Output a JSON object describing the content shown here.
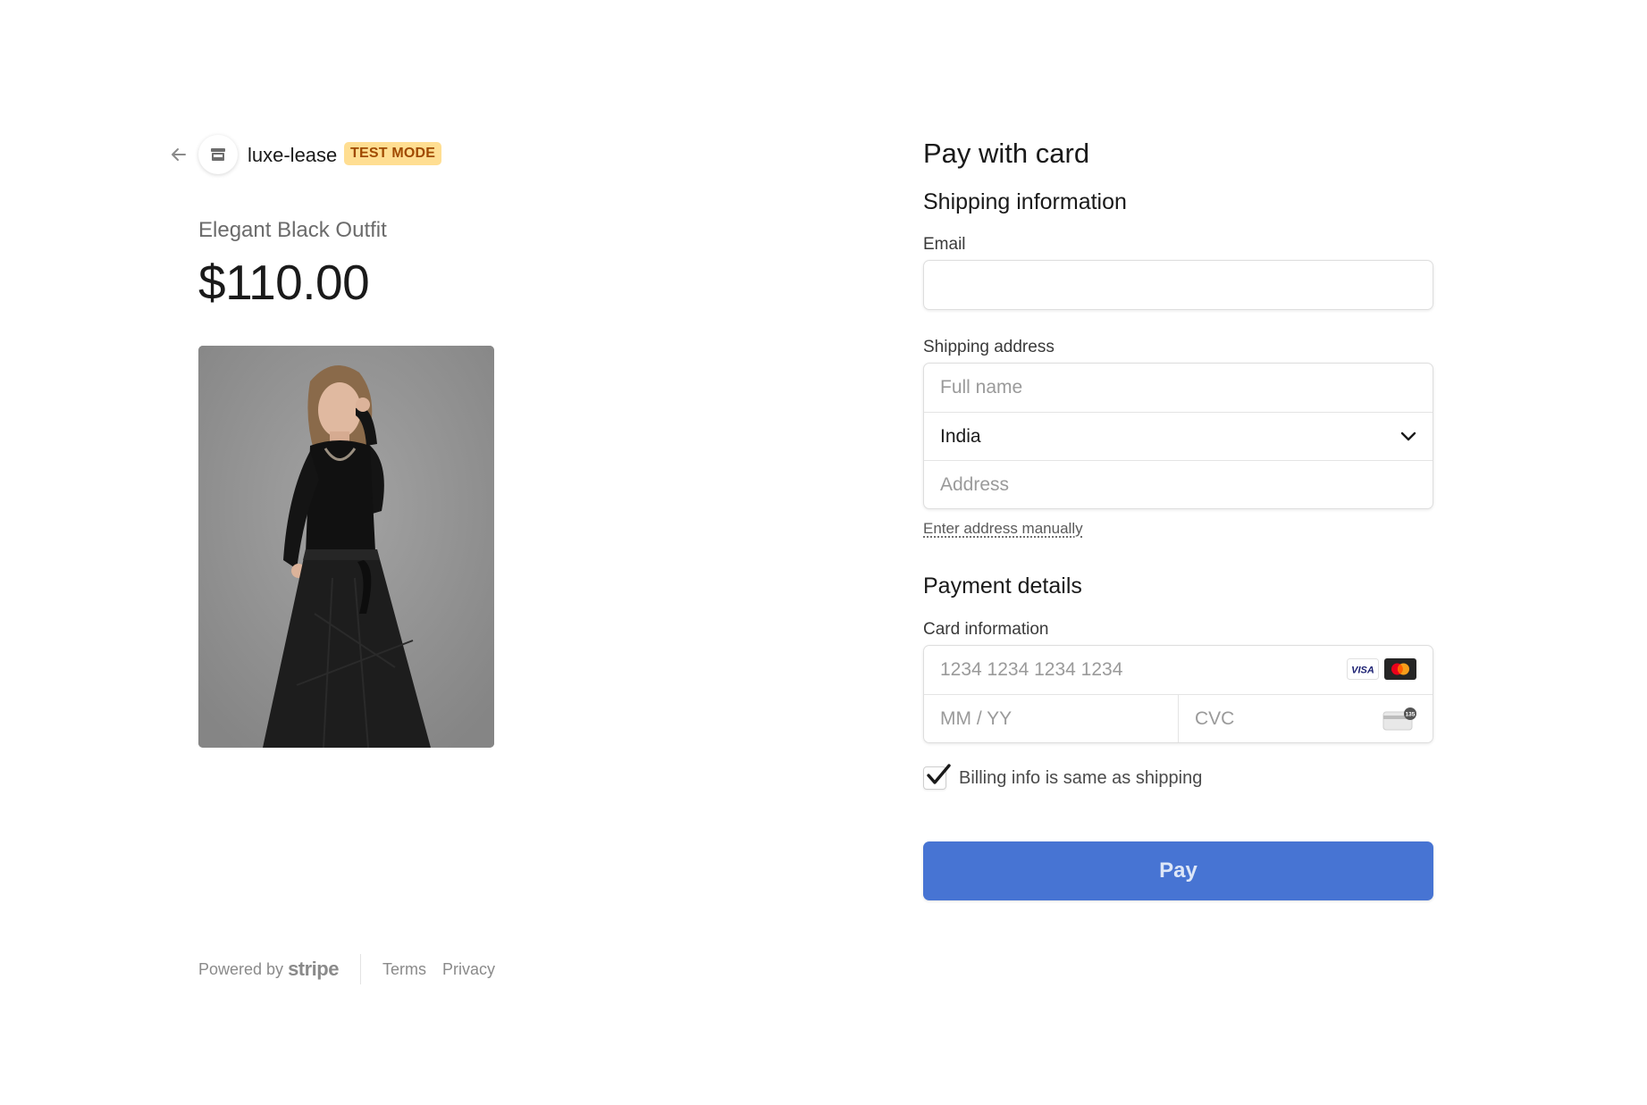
{
  "merchant": {
    "name": "luxe-lease",
    "badge": "TEST MODE"
  },
  "product": {
    "name": "Elegant Black Outfit",
    "price": "$110.00"
  },
  "footer": {
    "powered_by": "Powered by",
    "brand": "stripe",
    "terms": "Terms",
    "privacy": "Privacy"
  },
  "form": {
    "title": "Pay with card",
    "shipping_title": "Shipping information",
    "email_label": "Email",
    "email_value": "",
    "shipping_address_label": "Shipping address",
    "full_name_placeholder": "Full name",
    "country": "India",
    "address_placeholder": "Address",
    "enter_manually": "Enter address manually",
    "payment_title": "Payment details",
    "card_info_label": "Card information",
    "card_number_placeholder": "1234 1234 1234 1234",
    "expiry_placeholder": "MM / YY",
    "cvc_placeholder": "CVC",
    "billing_same": "Billing info is same as shipping",
    "billing_same_checked": true,
    "pay_label": "Pay"
  },
  "icons": {
    "back": "arrow-left-icon",
    "store": "store-icon",
    "visa": "visa-icon",
    "mastercard": "mastercard-icon",
    "cvc": "cvc-card-icon",
    "dropdown": "chevron-down-icon",
    "check": "checkmark-icon"
  },
  "colors": {
    "pay_button": "#4774d3",
    "badge_bg": "#ffde92",
    "badge_text": "#a04a00"
  }
}
